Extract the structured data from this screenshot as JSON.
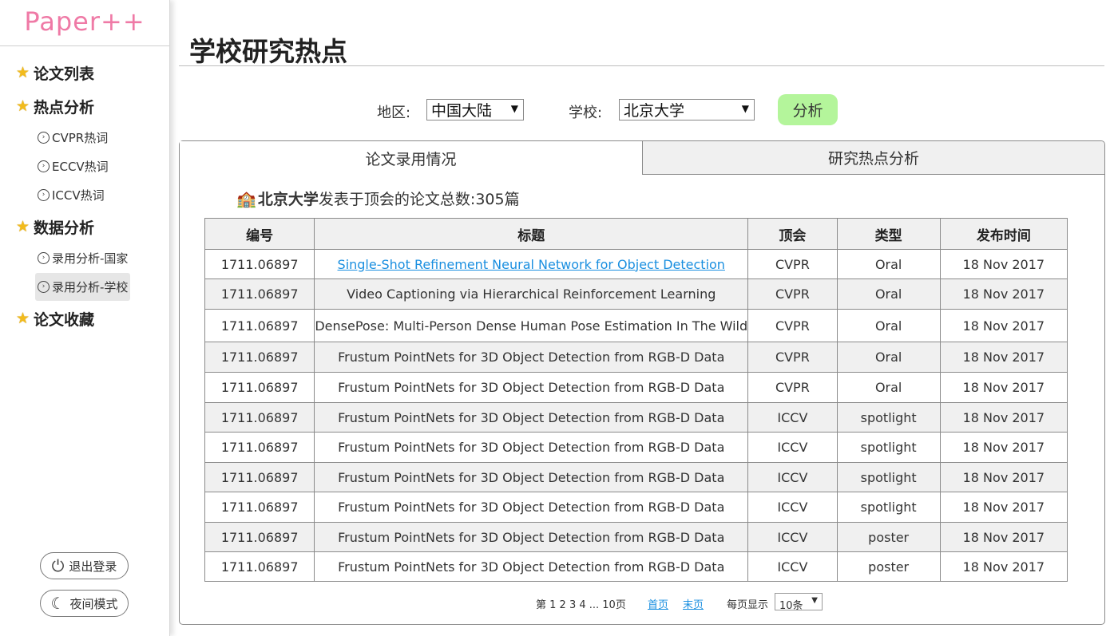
{
  "app": {
    "logo": "Paper++"
  },
  "sidebar": {
    "items": [
      {
        "type": "section",
        "label": "论文列表",
        "name": "sidebar-item-paper-list"
      },
      {
        "type": "section",
        "label": "热点分析",
        "name": "sidebar-item-hotspot-analysis"
      },
      {
        "type": "sub",
        "label": "CVPR热词",
        "name": "sidebar-item-cvpr-hotwords"
      },
      {
        "type": "sub",
        "label": "ECCV热词",
        "name": "sidebar-item-eccv-hotwords"
      },
      {
        "type": "sub",
        "label": "ICCV热词",
        "name": "sidebar-item-iccv-hotwords"
      },
      {
        "type": "section",
        "label": "数据分析",
        "name": "sidebar-item-data-analysis"
      },
      {
        "type": "sub",
        "label": "录用分析-国家",
        "name": "sidebar-item-accept-country"
      },
      {
        "type": "sub",
        "label": "录用分析-学校",
        "name": "sidebar-item-accept-school",
        "active": true
      },
      {
        "type": "section",
        "label": "论文收藏",
        "name": "sidebar-item-favorites"
      }
    ],
    "logout_label": "退出登录",
    "night_label": "夜间模式"
  },
  "main": {
    "title": "学校研究热点",
    "filters": {
      "region_label": "地区:",
      "region_value": "中国大陆",
      "school_label": "学校:",
      "school_value": "北京大学",
      "analyze_label": "分析"
    },
    "tabs": [
      {
        "label": "论文录用情况",
        "active": true
      },
      {
        "label": "研究热点分析",
        "active": false
      }
    ],
    "summary": {
      "school": "北京大学",
      "text": "发表于顶会的论文总数:305篇"
    },
    "table": {
      "headers": [
        "编号",
        "标题",
        "顶会",
        "类型",
        "发布时间"
      ],
      "rows": [
        [
          "1711.06897",
          "Single-Shot Refinement Neural Network for Object Detection",
          "CVPR",
          "Oral",
          "18 Nov 2017"
        ],
        [
          "1711.06897",
          "Video Captioning via Hierarchical Reinforcement Learning",
          "CVPR",
          "Oral",
          "18 Nov 2017"
        ],
        [
          "1711.06897",
          "DensePose: Multi-Person Dense Human Pose Estimation In The Wild",
          "CVPR",
          "Oral",
          "18 Nov 2017"
        ],
        [
          "1711.06897",
          "Frustum PointNets for 3D Object Detection from RGB-D Data",
          "CVPR",
          "Oral",
          "18 Nov 2017"
        ],
        [
          "1711.06897",
          "Frustum PointNets for 3D Object Detection from RGB-D Data",
          "CVPR",
          "Oral",
          "18 Nov 2017"
        ],
        [
          "1711.06897",
          "Frustum PointNets for 3D Object Detection from RGB-D Data",
          "ICCV",
          "spotlight",
          "18 Nov 2017"
        ],
        [
          "1711.06897",
          "Frustum PointNets for 3D Object Detection from RGB-D Data",
          "ICCV",
          "spotlight",
          "18 Nov 2017"
        ],
        [
          "1711.06897",
          "Frustum PointNets for 3D Object Detection from RGB-D Data",
          "ICCV",
          "spotlight",
          "18 Nov 2017"
        ],
        [
          "1711.06897",
          "Frustum PointNets for 3D Object Detection from RGB-D Data",
          "ICCV",
          "spotlight",
          "18 Nov 2017"
        ],
        [
          "1711.06897",
          "Frustum PointNets for 3D Object Detection from RGB-D Data",
          "ICCV",
          "poster",
          "18 Nov 2017"
        ],
        [
          "1711.06897",
          "Frustum PointNets for 3D Object Detection from RGB-D Data",
          "ICCV",
          "poster",
          "18 Nov 2017"
        ]
      ],
      "linked_row": 0
    },
    "pager": {
      "pages_text": "第 1 2 3 4 ... 10页",
      "first_label": "首页",
      "last_label": "末页",
      "per_page_label": "每页显示",
      "per_page_value": "10条"
    }
  },
  "colors": {
    "logo": "#ef7aa6",
    "analyze_button": "#b4f59b",
    "link": "#1a8fe0",
    "star": "#f2bb1c"
  }
}
